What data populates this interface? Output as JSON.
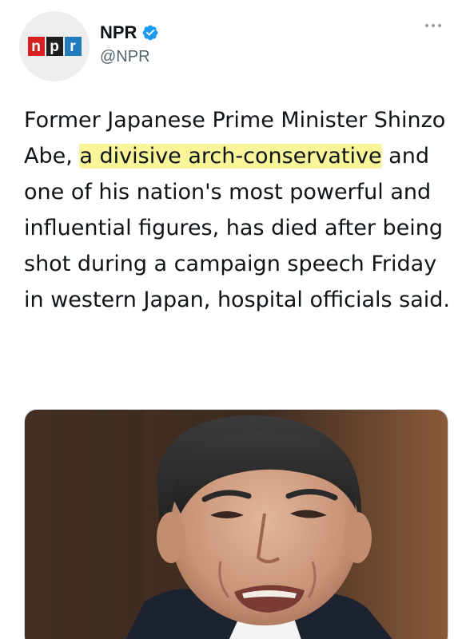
{
  "account": {
    "display_name": "NPR",
    "handle": "@NPR",
    "avatar_logo_letters": [
      "n",
      "p",
      "r"
    ],
    "avatar_logo_colors": [
      "#d62021",
      "#1e1e1e",
      "#237bbd"
    ],
    "verified": true,
    "verified_color": "#1d9bf0"
  },
  "tweet": {
    "text_before": "Former Japanese Prime Minister Shinzo Abe, ",
    "highlight": "a divisive arch-conservative",
    "text_after": " and one of his nation's most powerful and influential figures, has died after being shot during a campaign speech Friday in western Japan, hospital officials said.",
    "highlight_color": "#fbf59a"
  },
  "media": {
    "icon": "photo-of-man-in-suit"
  },
  "icons": {
    "more": "more-horizontal-icon",
    "verified": "verified-badge-icon"
  }
}
